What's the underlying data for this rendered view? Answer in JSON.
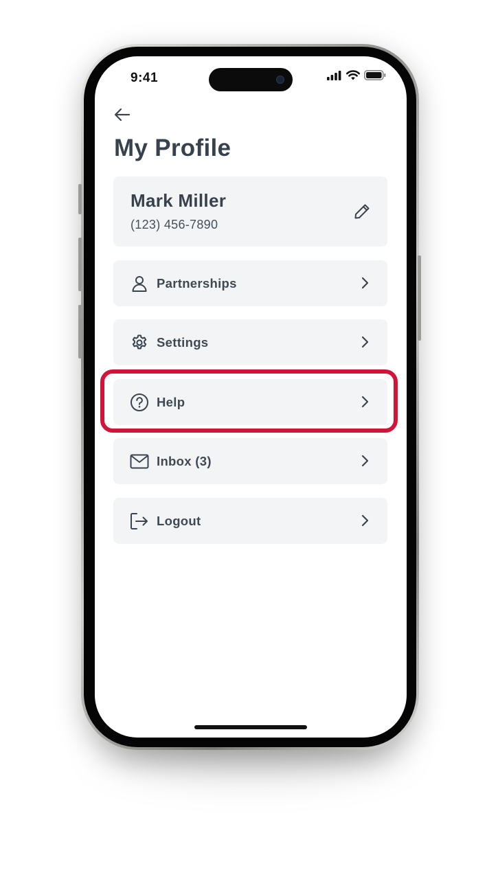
{
  "status_bar": {
    "time": "9:41"
  },
  "header": {
    "title": "My Profile",
    "back_icon": "arrow-left-icon"
  },
  "profile": {
    "name": "Mark Miller",
    "phone": "(123) 456-7890",
    "edit_icon": "pencil-icon"
  },
  "menu": {
    "items": [
      {
        "label": "Partnerships",
        "icon": "user-icon"
      },
      {
        "label": "Settings",
        "icon": "gear-icon"
      },
      {
        "label": "Help",
        "icon": "question-circle-icon"
      },
      {
        "label": "Inbox (3)",
        "icon": "mail-icon"
      },
      {
        "label": "Logout",
        "icon": "logout-icon"
      }
    ],
    "highlighted_item": "Help"
  },
  "colors": {
    "text": "#38424c",
    "card_background": "#f3f4f6",
    "highlight": "#d0143a"
  }
}
